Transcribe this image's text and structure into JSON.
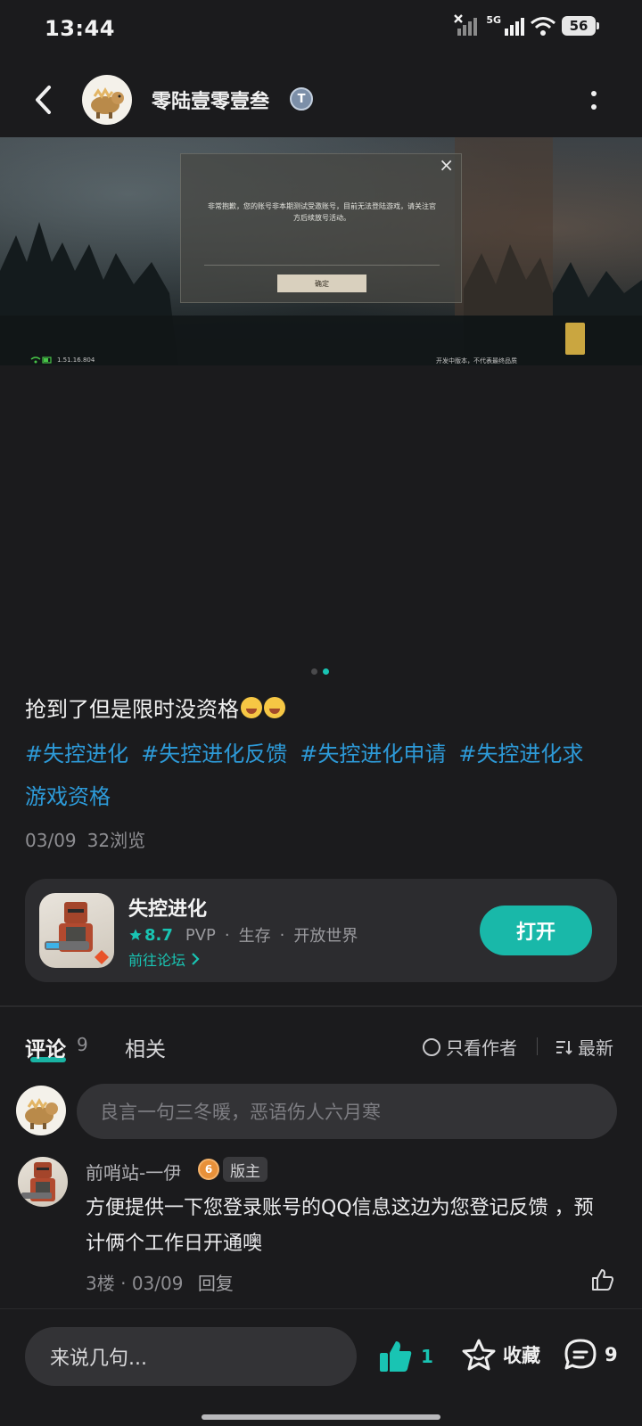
{
  "status_bar": {
    "time": "13:44",
    "network": "5G",
    "battery": "56"
  },
  "header": {
    "author": "零陆壹零壹叁",
    "badge_letter": "T"
  },
  "media": {
    "dialog_message": "非常抱歉，您的账号非本期测试受邀账号，目前无法登陆游戏，请关注官方后续放号活动。",
    "dialog_button": "确定",
    "dialog_close": "×",
    "version": "1.51.16.804",
    "footer_note": "开发中版本，不代表最终品质",
    "pager_count": 2,
    "pager_active": 1
  },
  "post": {
    "text": "抢到了但是限时没资格",
    "hashtags": [
      "#失控进化",
      "#失控进化反馈",
      "#失控进化申请",
      "#失控进化求游戏资格"
    ],
    "date": "03/09",
    "views": "32浏览"
  },
  "game_card": {
    "title": "失控进化",
    "rating": "8.7",
    "tags": [
      "PVP",
      "生存",
      "开放世界"
    ],
    "forum_link": "前往论坛",
    "open_button": "打开"
  },
  "tabs": {
    "comments_label": "评论",
    "comments_count": "9",
    "related_label": "相关",
    "author_only": "只看作者",
    "sort": "最新"
  },
  "comment_input_placeholder": "良言一句三冬暖，恶语伤人六月寒",
  "comments": [
    {
      "author": "前哨站-一伊",
      "level": "6",
      "role": "版主",
      "body": "方便提供一下您登录账号的QQ信息这边为您登记反馈 ，预计俩个工作日开通噢",
      "floor": "3楼",
      "date": "03/09",
      "reply": "回复"
    }
  ],
  "bottom_bar": {
    "input_placeholder": "来说几句...",
    "likes": "1",
    "favorite_label": "收藏",
    "comment_count": "9"
  },
  "colors": {
    "accent": "#19c4b3",
    "hashtag": "#2d9ad8",
    "background": "#1b1b1d",
    "card": "#2c2c2f"
  }
}
